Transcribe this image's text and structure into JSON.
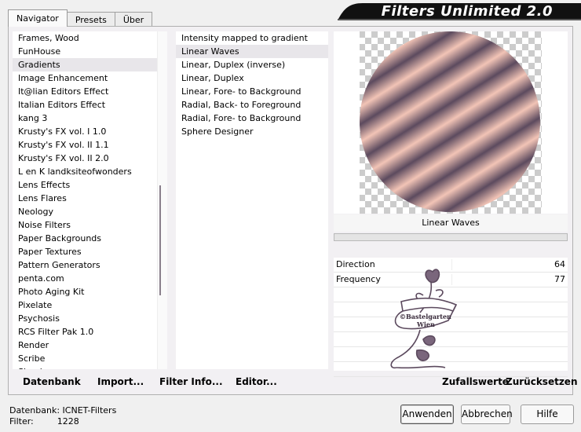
{
  "tabs": [
    "Navigator",
    "Presets",
    "Über"
  ],
  "title": "Filters Unlimited 2.0",
  "categories": {
    "selected_index": 2,
    "items": [
      "Frames, Wood",
      "FunHouse",
      "Gradients",
      "Image Enhancement",
      "It@lian Editors Effect",
      "Italian Editors Effect",
      "kang 3",
      "Krusty's FX vol. I 1.0",
      "Krusty's FX vol. II 1.1",
      "Krusty's FX vol. II 2.0",
      "L en K landksiteofwonders",
      "Lens Effects",
      "Lens Flares",
      "Neology",
      "Noise Filters",
      "Paper Backgrounds",
      "Paper Textures",
      "Pattern Generators",
      "penta.com",
      "Photo Aging Kit",
      "Pixelate",
      "Psychosis",
      "RCS Filter Pak 1.0",
      "Render",
      "Scribe",
      "Simple"
    ]
  },
  "filters": {
    "selected_index": 1,
    "items": [
      "Intensity mapped to gradient",
      "Linear Waves",
      "Linear, Duplex (inverse)",
      "Linear, Duplex",
      "Linear, Fore- to Background",
      "Radial, Back- to Foreground",
      "Radial, Fore- to Background",
      "Sphere Designer"
    ]
  },
  "preview": {
    "filter_name": "Linear Waves"
  },
  "params": [
    {
      "label": "Direction",
      "value": "64"
    },
    {
      "label": "Frequency",
      "value": "77"
    }
  ],
  "watermark": {
    "line1": "©Bastelgarten",
    "line2": "Wien"
  },
  "bottom_links": {
    "datenbank": "Datenbank",
    "import": "Import...",
    "filter_info": "Filter Info...",
    "editor": "Editor...",
    "zufallswerte": "Zufallswerte",
    "zuruecksetzen": "Zurücksetzen"
  },
  "status": {
    "datenbank_label": "Datenbank:",
    "datenbank_value": "ICNET-Filters",
    "filter_label": "Filter:",
    "filter_value": "1228"
  },
  "buttons": {
    "anwenden": "Anwenden",
    "abbrechen": "Abbrechen",
    "hilfe": "Hilfe"
  },
  "colors": {
    "wave_dark": "#5c4a5e",
    "wave_light": "#f2c4b6",
    "title_bg": "#111111"
  }
}
